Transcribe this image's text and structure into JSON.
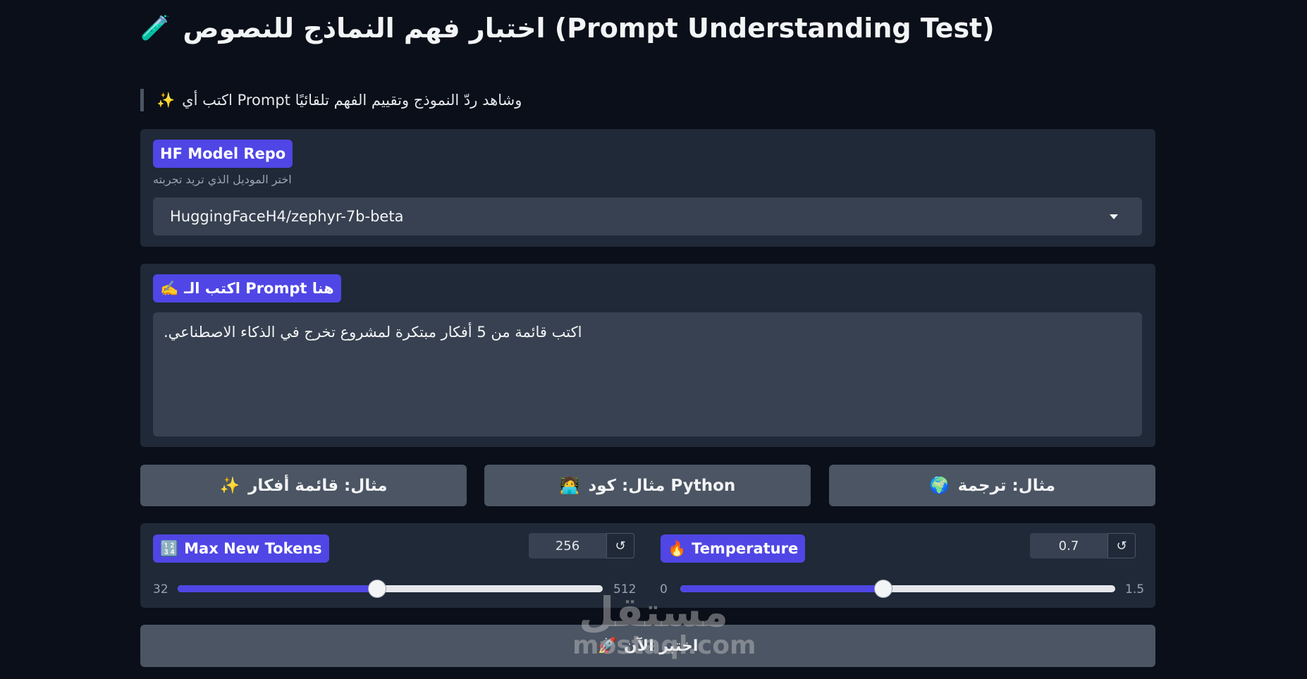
{
  "header": {
    "title": "اختبار فهم النماذج للنصوص (Prompt Understanding Test)",
    "title_icon": "🧪"
  },
  "intro": {
    "text": "اكتب أي Prompt وشاهد ردّ النموذج وتقييم الفهم تلقائيًا",
    "icon": "✨"
  },
  "model": {
    "label": "HF Model Repo",
    "hint": "اختر الموديل الذي تريد تجربته",
    "selected": "HuggingFaceH4/zephyr-7b-beta"
  },
  "prompt": {
    "label": "اكتب الـ Prompt هنا",
    "label_icon": "✍️",
    "value": "اكتب قائمة من 5 أفكار مبتكرة لمشروع تخرج في الذكاء الاصطناعي."
  },
  "examples": [
    {
      "label": "مثال: قائمة أفكار",
      "icon": "✨"
    },
    {
      "label": "مثال: كود Python",
      "icon": "🧑‍💻"
    },
    {
      "label": "مثال: ترجمة",
      "icon": "🌍"
    }
  ],
  "max_tokens": {
    "label": "Max New Tokens",
    "icon": "🔢",
    "value": "256",
    "min": "32",
    "max": "512",
    "fraction": 0.469
  },
  "temperature": {
    "label": "Temperature",
    "icon": "🔥",
    "value": "0.7",
    "min": "0",
    "max": "1.5",
    "fraction": 0.467
  },
  "reset_glyph": "↺",
  "submit": {
    "label": "اختبر الآن",
    "icon": "🚀"
  },
  "watermark": {
    "arabic": "مستقل",
    "latin": "mostaql.com"
  },
  "colors": {
    "background": "#0b0f19",
    "panel": "#1f2937",
    "accent": "#4f46e5",
    "button": "#4b5563"
  }
}
